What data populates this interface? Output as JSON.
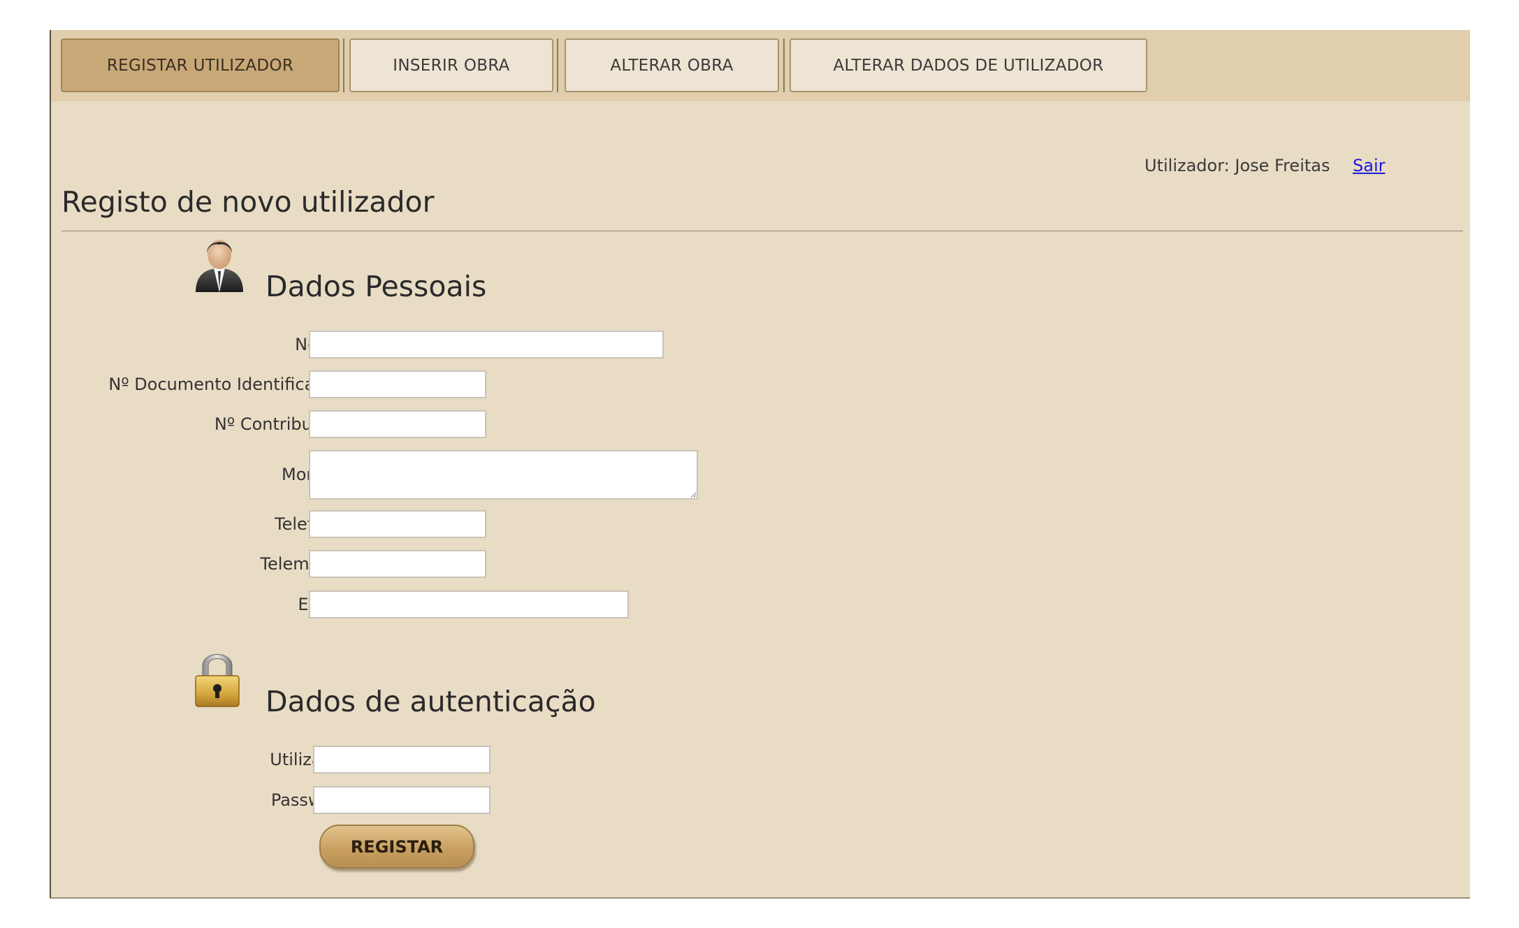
{
  "tabs": [
    {
      "label": "REGISTAR UTILIZADOR",
      "active": true
    },
    {
      "label": "INSERIR OBRA",
      "active": false
    },
    {
      "label": "ALTERAR OBRA",
      "active": false
    },
    {
      "label": "ALTERAR DADOS DE UTILIZADOR",
      "active": false
    }
  ],
  "header": {
    "user_text": "Utilizador: Jose Freitas",
    "logout_label": "Sair"
  },
  "page": {
    "title": "Registo de novo utilizador"
  },
  "personal": {
    "title": "Dados Pessoais",
    "icon": "person-icon",
    "fields": {
      "nome": {
        "label": "Nome:",
        "value": ""
      },
      "documento": {
        "label": "Nº Documento Identificação:",
        "value": ""
      },
      "contribuinte": {
        "label": "Nº Contribuinte:",
        "value": ""
      },
      "morada": {
        "label": "Morada:",
        "value": ""
      },
      "telefone": {
        "label": "Telefone:",
        "value": ""
      },
      "telemovel": {
        "label": "Telemóvel:",
        "value": ""
      },
      "email": {
        "label": "Email:",
        "value": ""
      }
    }
  },
  "auth": {
    "title": "Dados de autenticação",
    "icon": "padlock-icon",
    "fields": {
      "utilizador": {
        "label": "Utilizador:",
        "value": ""
      },
      "password": {
        "label": "Password:",
        "value": ""
      }
    }
  },
  "submit": {
    "label": "REGISTAR"
  },
  "colors": {
    "background": "#e9dcc5",
    "tabbar": "#e0cead",
    "active_tab": "#c9a878",
    "button": "#c9a060",
    "link": "#1a1adb"
  }
}
